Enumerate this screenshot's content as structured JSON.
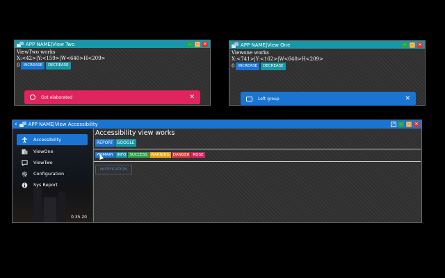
{
  "window_two": {
    "title": "APP NAME|View Two",
    "heading": "ViewTwo works",
    "coords": "X:<42>|Y:<159>|W<640>H<209>",
    "counter": "0",
    "increase_label": "INCREASE",
    "decrease_label": "DECREASE",
    "toast": {
      "text": "Got elaborated",
      "close": "✕",
      "color": "#e0245e"
    }
  },
  "window_one": {
    "title": "APP NAME|View One",
    "heading": "Viewone works",
    "coords": "X:<741>|Y:<162>|W<640>H<209>",
    "counter": "0",
    "increase_label": "INCREASE",
    "decrease_label": "DECREASE",
    "toast": {
      "text": "Left group",
      "close": "✕",
      "color": "#1a75d2"
    }
  },
  "main_window": {
    "back": "‹",
    "title": "APP NAME|View Accessibility",
    "sidebar": {
      "items": [
        {
          "label": "Accessibility",
          "icon": "accessibility-icon",
          "active": true
        },
        {
          "label": "ViewOne",
          "icon": "folder-icon",
          "active": false
        },
        {
          "label": "ViewTwo",
          "icon": "chat-icon",
          "active": false
        },
        {
          "label": "Configuration",
          "icon": "gear-icon",
          "active": false
        },
        {
          "label": "Sys Report",
          "icon": "info-icon",
          "active": false
        }
      ],
      "version": "0.35.20"
    },
    "heading": "Accessibility view works",
    "buttons": [
      "REPORT",
      "GOOGLE"
    ],
    "chips": [
      {
        "label": "PRIMARY",
        "color": "#1a75d2"
      },
      {
        "label": "INFO",
        "color": "#1797a7"
      },
      {
        "label": "SUCCESS",
        "color": "#2e9e4a"
      },
      {
        "label": "WARNING",
        "color": "#e8a413"
      },
      {
        "label": "DANGER",
        "color": "#d63a3a"
      },
      {
        "label": "ROSE",
        "color": "#d6245e"
      }
    ],
    "notification_label": "NOTIFICATION"
  },
  "colors": {
    "teal_titlebar": "#1797a7",
    "blue_titlebar": "#1a75d2",
    "minimize": "#28a745",
    "maximize": "#f0a030",
    "close": "#dc3535"
  }
}
